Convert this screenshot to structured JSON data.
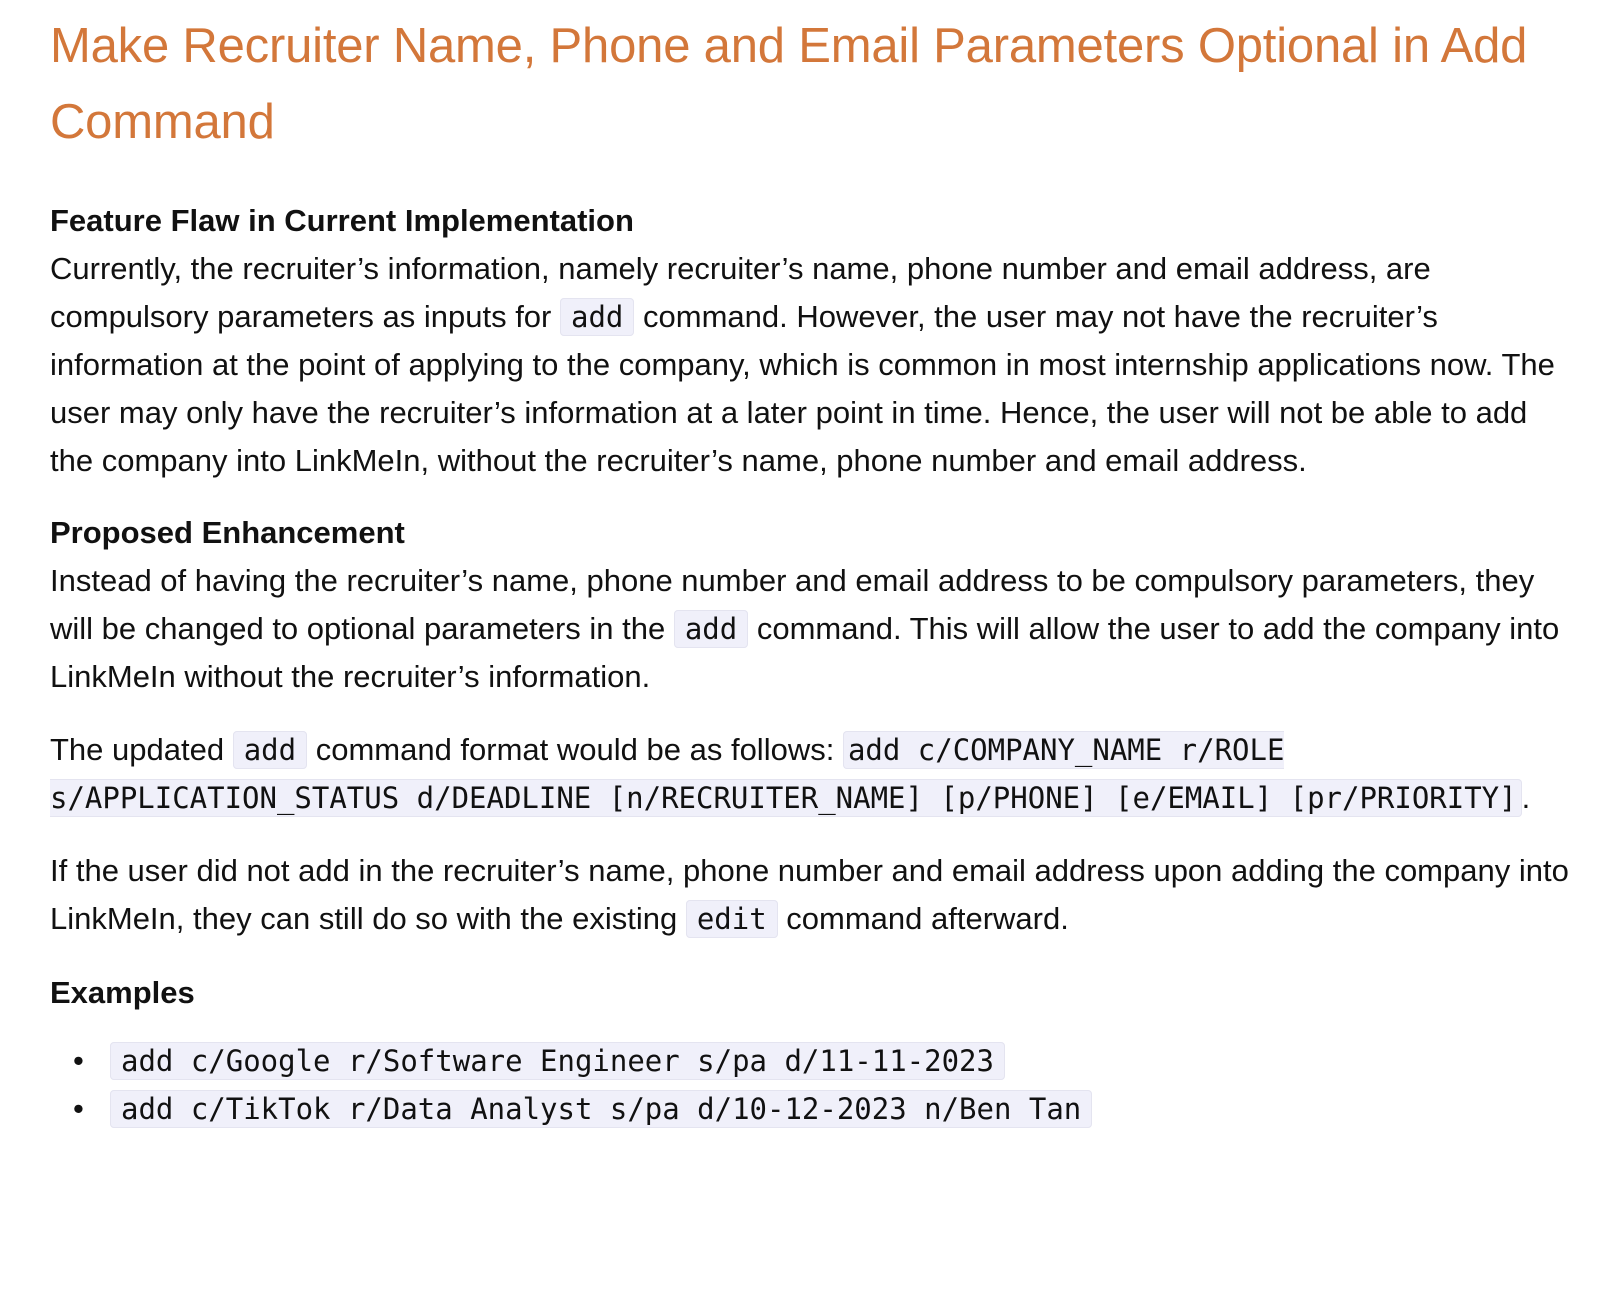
{
  "title": "Make Recruiter Name, Phone and Email Parameters Optional in Add Command",
  "sections": {
    "flaw": {
      "heading": "Feature Flaw in Current Implementation",
      "text_1": "Currently, the recruiter’s information, namely recruiter’s name, phone number and email address, are compulsory parameters as inputs for ",
      "code_1": "add",
      "text_2": " command. However, the user may not have the recruiter’s information at the point of applying to the company, which is common in most internship applications now. The user may only have the recruiter’s information at a later point in time. Hence, the user will not be able to add the company into LinkMeIn, without the recruiter’s name, phone number and email address."
    },
    "enhancement": {
      "heading": "Proposed Enhancement",
      "text_1": "Instead of having the recruiter’s name, phone number and email address to be compulsory parameters, they will be changed to optional parameters in the ",
      "code_1": "add",
      "text_2": " command. This will allow the user to add the company into LinkMeIn without the recruiter’s information."
    },
    "updated_format": {
      "text_1": "The updated ",
      "code_1": "add",
      "text_2": " command format would be as follows: ",
      "code_format": "add c/COMPANY_NAME r/ROLE s/APPLICATION_STATUS d/DEADLINE [n/RECRUITER_NAME] [p/PHONE] [e/EMAIL] [pr/PRIORITY]",
      "text_3": "."
    },
    "edit_note": {
      "text_1": "If the user did not add in the recruiter’s name, phone number and email address upon adding the company into LinkMeIn, they can still do so with the existing ",
      "code_1": "edit",
      "text_2": " command afterward."
    },
    "examples": {
      "heading": "Examples",
      "bullet": "•",
      "items": [
        "add c/Google r/Software Engineer s/pa d/11-11-2023",
        "add c/TikTok r/Data Analyst s/pa d/10-12-2023 n/Ben Tan"
      ]
    }
  }
}
